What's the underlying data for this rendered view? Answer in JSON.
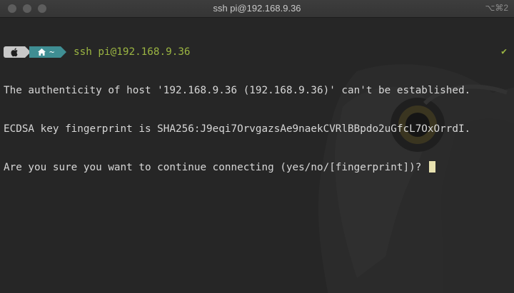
{
  "window": {
    "title": "ssh pi@192.168.9.36",
    "shortcut": "⌥⌘2",
    "controls": [
      "close",
      "minimize",
      "zoom"
    ]
  },
  "prompt": {
    "os_icon": "apple-icon",
    "dir_icon": "home-icon",
    "dir": "~",
    "command": "ssh pi@192.168.9.36",
    "status": "✔"
  },
  "output": [
    "The authenticity of host '192.168.9.36 (192.168.9.36)' can't be established.",
    "ECDSA key fingerprint is SHA256:J9eqi7OrvgazsAe9naekCVRlBBpdo2uGfcL7OxOrrdI.",
    "Are you sure you want to continue connecting (yes/no/[fingerprint])? "
  ],
  "colors": {
    "background": "#262626",
    "prompt_command": "#9bb542",
    "dir_segment": "#3f8e93",
    "cursor": "#e8e2b0"
  }
}
